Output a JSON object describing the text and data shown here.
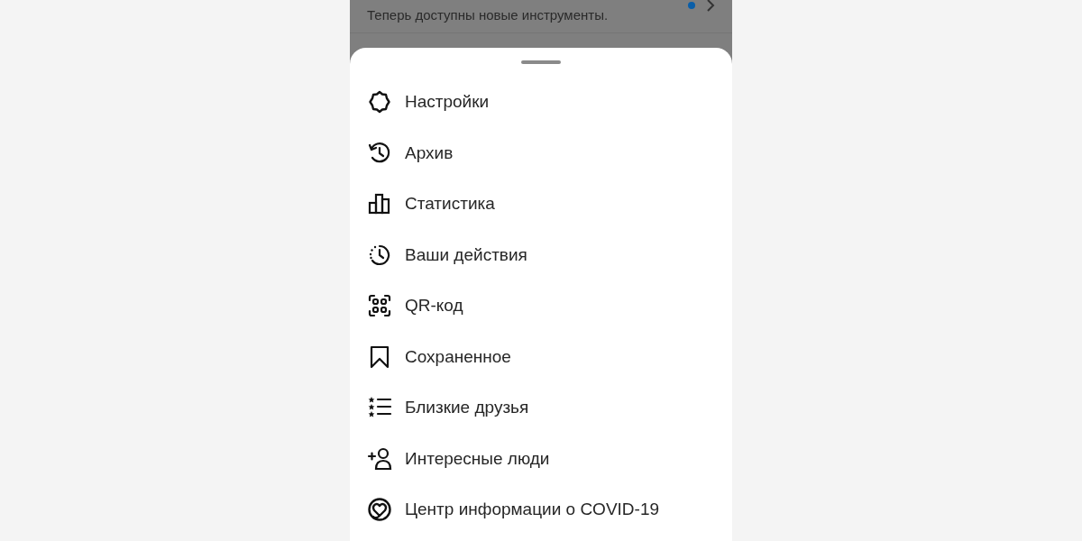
{
  "background_row": {
    "subtitle": "Теперь доступны новые инструменты.",
    "unread": true
  },
  "menu": [
    {
      "kind": "settings",
      "label": "Настройки"
    },
    {
      "kind": "archive",
      "label": "Архив"
    },
    {
      "kind": "stats",
      "label": "Статистика"
    },
    {
      "kind": "activity",
      "label": "Ваши действия"
    },
    {
      "kind": "qr",
      "label": "QR-код"
    },
    {
      "kind": "saved",
      "label": "Сохраненное"
    },
    {
      "kind": "friends",
      "label": "Близкие друзья"
    },
    {
      "kind": "people",
      "label": "Интересные люди"
    },
    {
      "kind": "covid",
      "label": "Центр информации о COVID-19"
    }
  ]
}
